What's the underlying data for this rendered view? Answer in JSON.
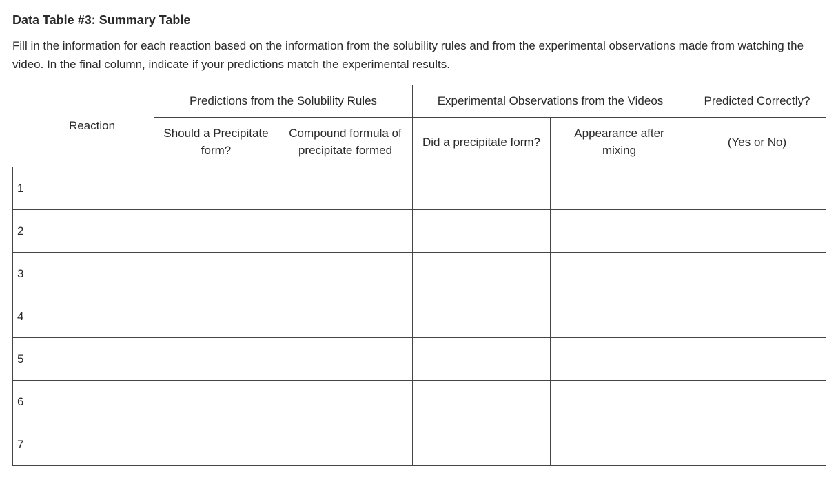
{
  "title": "Data Table #3: Summary Table",
  "instructions": "Fill in the information for each reaction based on the information from the solubility rules and from the experimental observations made from watching the video. In the final column, indicate if your predictions match the experimental results.",
  "headers": {
    "reaction": "Reaction",
    "predictions_group": "Predictions from the Solubility Rules",
    "should_form": "Should a Precipitate form?",
    "compound_formula": "Compound formula of precipitate formed",
    "experimental_group": "Experimental Observations from the Videos",
    "did_form": "Did a precipitate form?",
    "appearance": "Appearance after mixing",
    "predicted_correctly": "Predicted Correctly?",
    "yes_or_no": "(Yes or No)"
  },
  "rows": [
    {
      "num": "1"
    },
    {
      "num": "2"
    },
    {
      "num": "3"
    },
    {
      "num": "4"
    },
    {
      "num": "5"
    },
    {
      "num": "6"
    },
    {
      "num": "7"
    }
  ]
}
